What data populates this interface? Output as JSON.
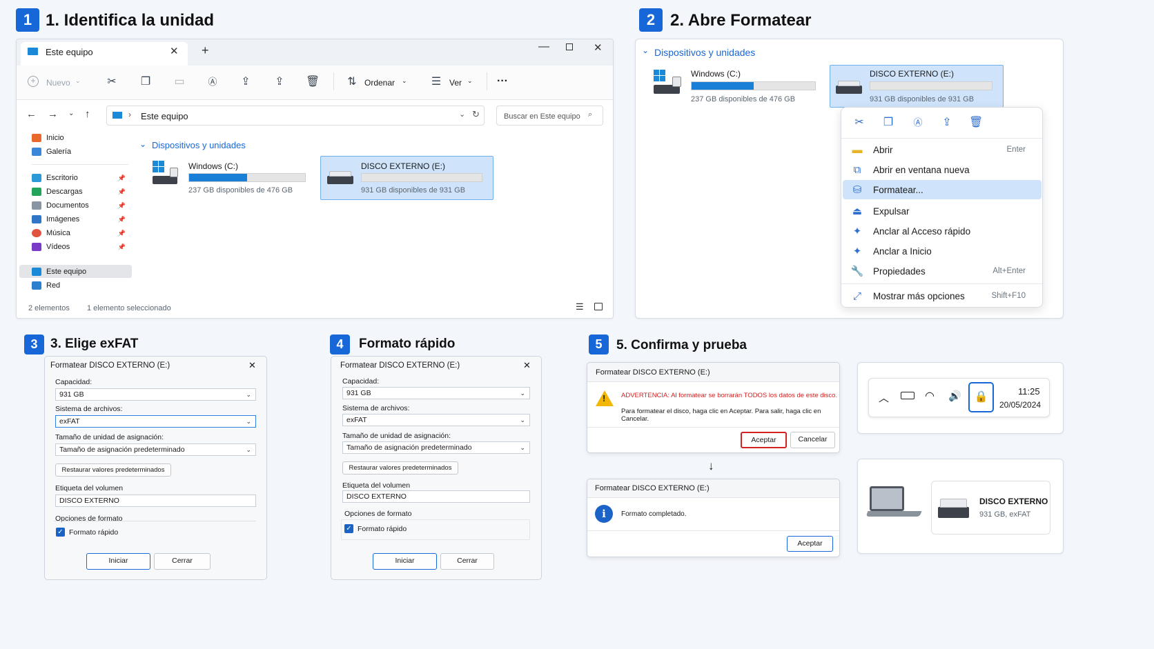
{
  "steps": {
    "s1_num": "1",
    "s1_title": "1. Identifica la unidad",
    "s2_num": "2",
    "s2_title": "2. Abre Formatear",
    "s3_num": "3",
    "s3_title": "3. Elige exFAT",
    "s4_num": "4",
    "s4_title": "Formato rápido",
    "s5_num": "5",
    "s5_title": "5. Confirma y prueba"
  },
  "explorer": {
    "tab_title": "Este equipo",
    "new_tab": "+",
    "toolbar": {
      "nuevo": "Nuevo",
      "ordenar": "Ordenar",
      "ver": "Ver",
      "more": "···"
    },
    "address": "Este equipo",
    "search_placeholder": "Buscar en Este equipo",
    "nav": {
      "inicio": "Inicio",
      "galeria": "Galería",
      "escritorio": "Escritorio",
      "descargas": "Descargas",
      "documentos": "Documentos",
      "imagenes": "Imágenes",
      "musica": "Música",
      "videos": "Vídeos",
      "este_equipo": "Este equipo",
      "red": "Red"
    },
    "section": "Dispositivos y unidades",
    "drive_c": {
      "name": "Windows (C:)",
      "space": "237 GB disponibles de 476 GB",
      "used_fraction": 0.5
    },
    "drive_e": {
      "name": "DISCO EXTERNO (E:)",
      "space": "931 GB disponibles de 931 GB",
      "used_fraction": 0.0
    },
    "status_count": "2 elementos",
    "status_sel": "1 elemento seleccionado"
  },
  "step2": {
    "section": "Dispositivos y unidades",
    "drive_c": {
      "name": "Windows (C:)",
      "space": "237 GB disponibles de 476 GB"
    },
    "drive_e": {
      "name": "DISCO EXTERNO (E:)",
      "space": "931 GB disponibles de 931 GB"
    },
    "menu": {
      "abrir": "Abrir",
      "abrir_sc": "Enter",
      "abrir_nueva": "Abrir en ventana nueva",
      "formatear": "Formatear...",
      "expulsar": "Expulsar",
      "anclar_acceso": "Anclar al Acceso rápido",
      "anclar_inicio": "Anclar a Inicio",
      "propiedades": "Propiedades",
      "propiedades_sc": "Alt+Enter",
      "mas_opciones": "Mostrar más opciones",
      "mas_opciones_sc": "Shift+F10"
    }
  },
  "format_dialog": {
    "title": "Formatear DISCO EXTERNO (E:)",
    "capacidad_label": "Capacidad:",
    "capacidad": "931 GB",
    "fs_label": "Sistema de archivos:",
    "fs": "exFAT",
    "alloc_label": "Tamaño de unidad de asignación:",
    "alloc": "Tamaño de asignación predeterminado",
    "restore": "Restaurar valores predeterminados",
    "vol_label": "Etiqueta del volumen",
    "vol": "DISCO EXTERNO",
    "options_label": "Opciones de formato",
    "quick": "Formato rápido",
    "start": "Iniciar",
    "close": "Cerrar"
  },
  "confirm": {
    "title": "Formatear DISCO EXTERNO (E:)",
    "warning": "ADVERTENCIA: Al formatear se borrarán TODOS los datos de este disco.",
    "info": "Para formatear el disco, haga clic en Aceptar. Para salir, haga clic en Cancelar.",
    "ok": "Aceptar",
    "cancel": "Cancelar",
    "arrow": "↓",
    "done_title": "Formatear DISCO EXTERNO (E:)",
    "done": "Formato completado.",
    "done_ok": "Aceptar"
  },
  "tray": {
    "time": "11:25",
    "date": "20/05/2024"
  },
  "result": {
    "name": "DISCO EXTERNO",
    "detail": "931 GB, exFAT"
  },
  "colors": {
    "accent": "#1767d8",
    "warning_red": "#d32020",
    "selected": "#cfe4fb"
  }
}
